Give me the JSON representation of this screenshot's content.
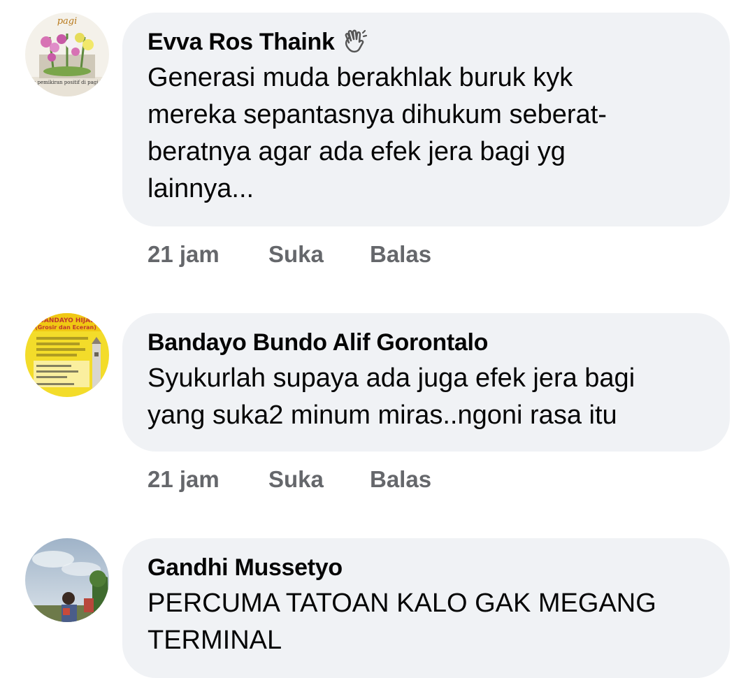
{
  "comments": [
    {
      "author": "Evva Ros Thaink",
      "author_badge_icon": "waving-hand-icon",
      "text_lines": [
        "Generasi muda berakhlak buruk kyk",
        "mereka sepantasnya dihukum seberat-",
        "beratnya agar ada efek jera bagi yg",
        "lainnya..."
      ],
      "time": "21 jam",
      "like_label": "Suka",
      "reply_label": "Balas",
      "avatar_caption": "Satu pemikiran positif di pagi hari",
      "avatar_top_text": "pagi"
    },
    {
      "author": "Bandayo Bundo Alif Gorontalo",
      "text_lines": [
        "Syukurlah supaya ada juga efek jera bagi",
        "yang suka2 minum miras..ngoni rasa itu"
      ],
      "time": "21 jam",
      "like_label": "Suka",
      "reply_label": "Balas",
      "avatar_title": "BANDAYO HIJAB",
      "avatar_subtitle": "(Grosir dan Eceran)"
    },
    {
      "author": "Gandhi Mussetyo",
      "text_lines": [
        "PERCUMA TATOAN KALO GAK MEGANG",
        "TERMINAL"
      ]
    }
  ],
  "colors": {
    "bubble": "#f0f2f5",
    "text": "#050505",
    "secondary": "#65676b"
  }
}
